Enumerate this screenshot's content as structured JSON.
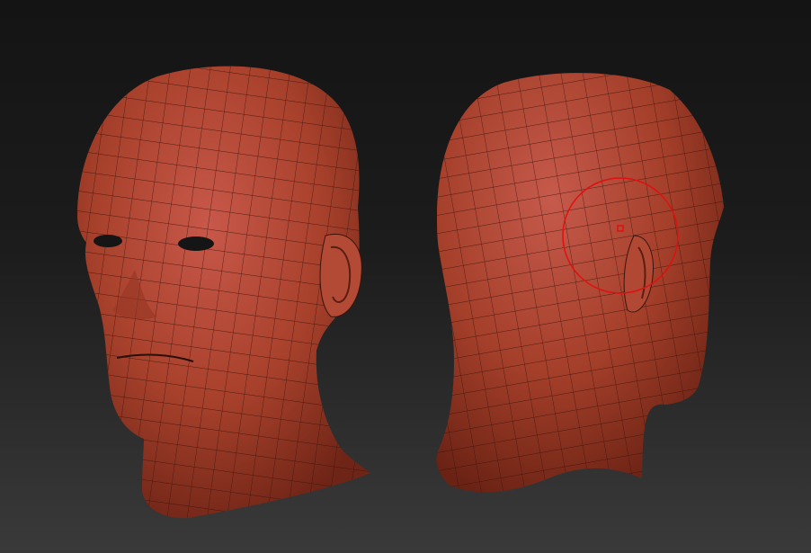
{
  "viewport": {
    "background_top": "#141414",
    "background_bottom": "#3a3a3a"
  },
  "models": [
    {
      "id": "head-front-three-quarter",
      "material_color": "#a8412c",
      "wireframe_color": "#3a140c"
    },
    {
      "id": "head-back-three-quarter",
      "material_color": "#a8412c",
      "wireframe_color": "#3a140c"
    }
  ],
  "brush_cursor": {
    "icon": "brush-circle-cursor",
    "color": "#e01010"
  }
}
